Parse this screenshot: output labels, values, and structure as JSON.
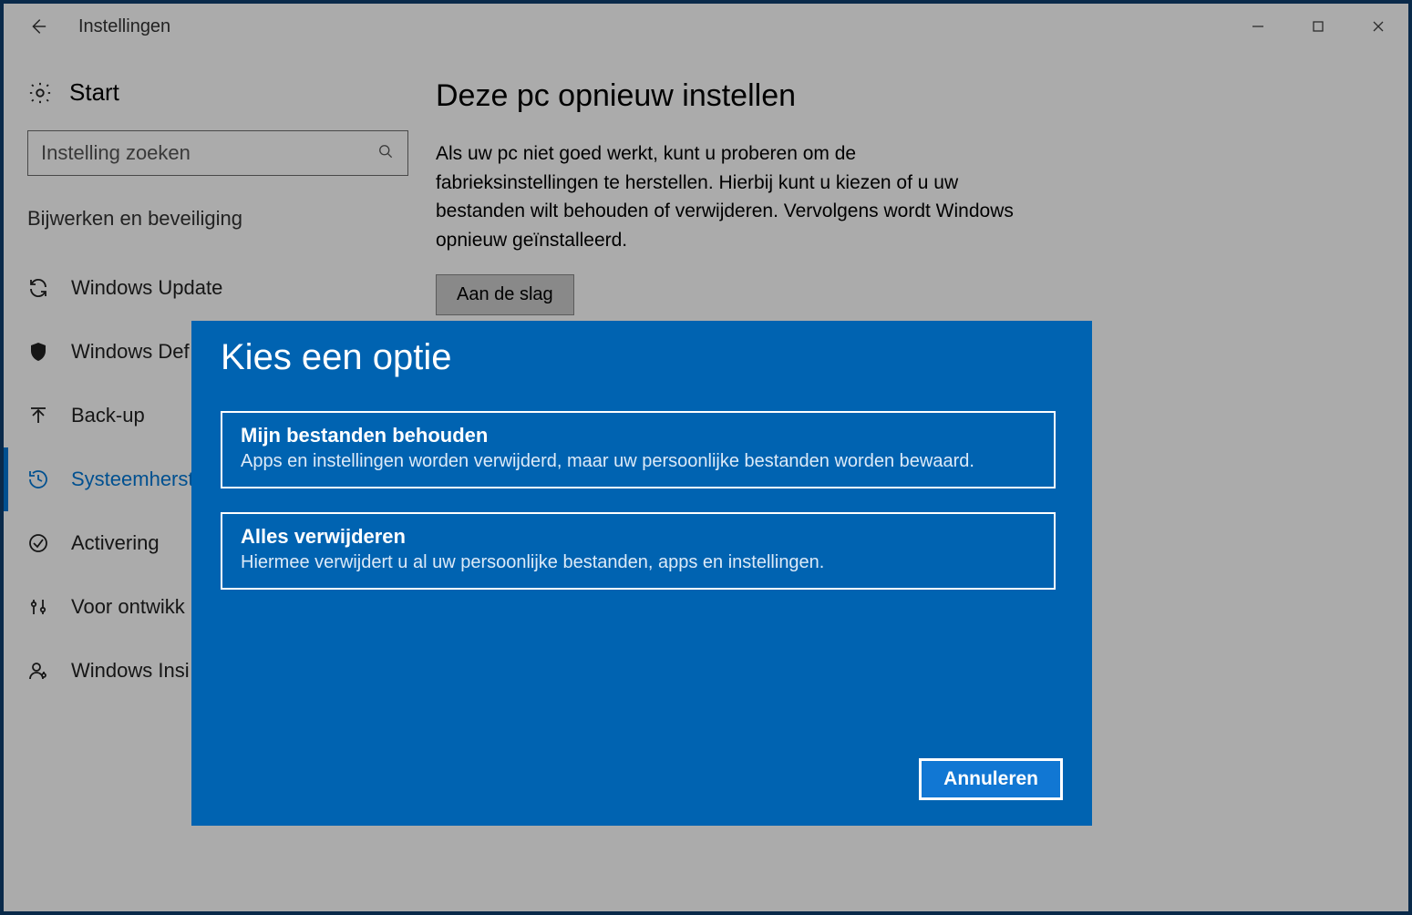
{
  "window": {
    "title": "Instellingen"
  },
  "sidebar": {
    "start_label": "Start",
    "search_placeholder": "Instelling zoeken",
    "section": "Bijwerken en beveiliging",
    "items": [
      {
        "label": "Windows Update"
      },
      {
        "label": "Windows Def"
      },
      {
        "label": "Back-up"
      },
      {
        "label": "Systeemherst"
      },
      {
        "label": "Activering"
      },
      {
        "label": "Voor ontwikk"
      },
      {
        "label": "Windows Insi"
      }
    ],
    "selected_index": 3
  },
  "content": {
    "heading": "Deze pc opnieuw instellen",
    "description": "Als uw pc niet goed werkt, kunt u proberen om de fabrieksinstellingen te herstellen. Hierbij kunt u kiezen of u uw bestanden wilt behouden of verwijderen. Vervolgens wordt Windows opnieuw geïnstalleerd.",
    "cta": "Aan de slag"
  },
  "modal": {
    "title": "Kies een optie",
    "options": [
      {
        "title": "Mijn bestanden behouden",
        "desc": "Apps en instellingen worden verwijderd, maar uw persoonlijke bestanden worden bewaard."
      },
      {
        "title": "Alles verwijderen",
        "desc": "Hiermee verwijdert u al uw persoonlijke bestanden, apps en instellingen."
      }
    ],
    "cancel": "Annuleren"
  }
}
